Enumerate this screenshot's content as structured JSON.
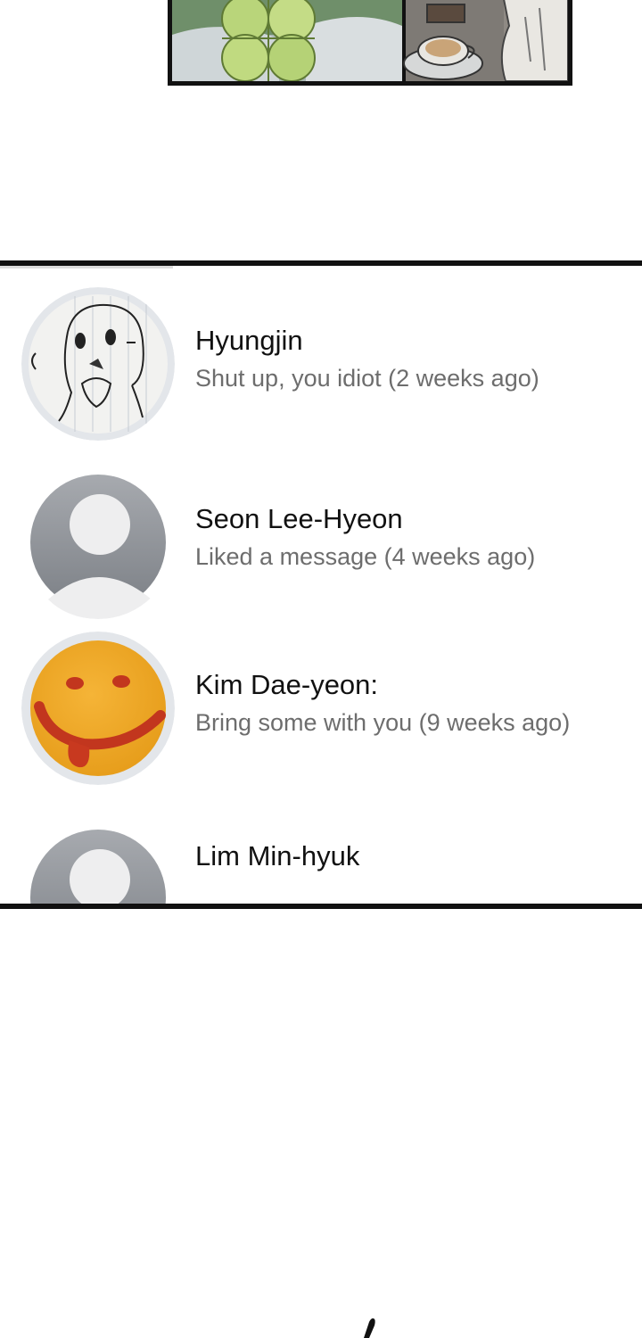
{
  "comic_panel": {
    "description_icon": "illustration-clover-coffee"
  },
  "chat_list": {
    "items": [
      {
        "name": "Hyungjin",
        "preview": "Shut up, you idiot (2 weeks ago)",
        "avatar": "sketched-dog-avatar"
      },
      {
        "name": "Seon Lee-Hyeon",
        "preview": "Liked a message (4 weeks ago)",
        "avatar": "default-user-avatar"
      },
      {
        "name": "Kim Dae-yeon:",
        "preview": "Bring some with you (9 weeks ago)",
        "avatar": "smiley-ketchup-avatar"
      },
      {
        "name": "Lim Min-hyuk",
        "preview": "",
        "avatar": "default-user-avatar"
      }
    ]
  },
  "colors": {
    "name_text": "#111111",
    "preview_text": "#6d6d6d",
    "panel_border": "#111111",
    "default_avatar_bg": "#8e9196",
    "avatar_ring": "#e3e6ea"
  }
}
